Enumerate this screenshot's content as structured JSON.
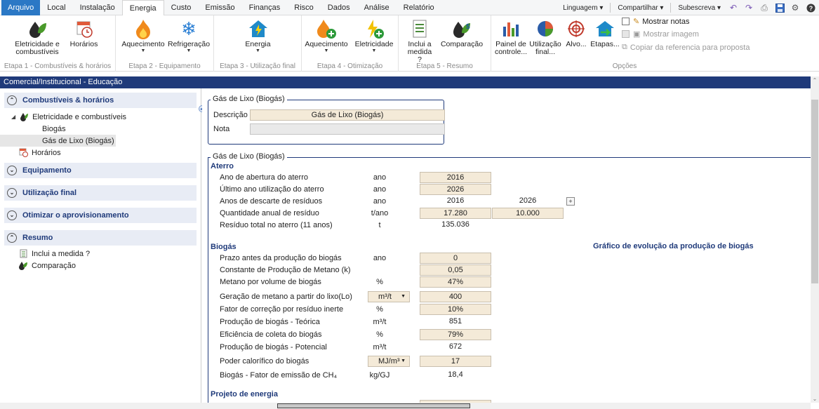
{
  "menubar": {
    "tabs": [
      "Arquivo",
      "Local",
      "Instalação",
      "Energia",
      "Custo",
      "Emissão",
      "Finanças",
      "Risco",
      "Dados",
      "Análise",
      "Relatório"
    ],
    "active_tab": "Energia",
    "language": "Linguagem ▾",
    "share": "Compartilhar ▾",
    "subscribe": "Subescreva ▾"
  },
  "ribbon": {
    "group1": {
      "label": "Etapa 1 - Combustíveis & horários",
      "btn1": "Eletricidade e combustíveis",
      "btn2": "Horários"
    },
    "group2": {
      "label": "Etapa 2 - Equipamento",
      "btn1": "Aquecimento",
      "btn2": "Refrigeração"
    },
    "group3": {
      "label": "Etapa 3 - Utilização final",
      "btn1": "Energia"
    },
    "group4": {
      "label": "Etapa 4 - Otimização",
      "btn1": "Aquecimento",
      "btn2": "Eletricidade"
    },
    "group5": {
      "label": "Etapa 5 - Resumo",
      "btn1": "Inclui a medida ?",
      "btn2": "Comparação"
    },
    "group6": {
      "label": "Opções",
      "btn1": "Painel de controle...",
      "btn2": "Utilização final...",
      "btn3": "Alvo...",
      "btn4": "Etapas...",
      "opt1": "Mostrar notas",
      "opt2": "Mostrar imagem",
      "opt3": "Copiar da referencia para proposta"
    }
  },
  "title": "Comercial/Institucional - Educação",
  "sidebar": {
    "sections": {
      "fuels": "Combustíveis & horários",
      "equipment": "Equipamento",
      "enduse": "Utilização final",
      "optimize": "Otimizar o aprovisionamento",
      "summary": "Resumo"
    },
    "tree": {
      "elec_fuels": "Eletricidade e combustíveis",
      "biogas": "Biogás",
      "landfill_gas": "Gás de Lixo (Biogás)",
      "schedules": "Horários",
      "include_measure": "Inclui a medida ?",
      "comparison": "Comparação"
    }
  },
  "main": {
    "box1": {
      "legend": "Gás de Lixo (Biogás)",
      "desc_label": "Descrição",
      "desc_value": "Gás de Lixo (Biogás)",
      "note_label": "Nota",
      "note_value": ""
    },
    "box2_legend": "Gás de Lixo (Biogás)",
    "aterro": {
      "title": "Aterro",
      "rows": [
        {
          "label": "Ano de abertura do aterro",
          "unit": "ano",
          "value": "2016"
        },
        {
          "label": "Último ano utilização do aterro",
          "unit": "ano",
          "value": "2026"
        },
        {
          "label": "Anos de descarte de resíduos",
          "unit": "ano",
          "value": "2016",
          "value2": "2026"
        },
        {
          "label": "Quantidade anual de resíduo",
          "unit": "t/ano",
          "value": "17.280",
          "value2": "10.000"
        },
        {
          "label": "Resíduo total no aterro (11 anos)",
          "unit": "t",
          "value": "135.036"
        }
      ]
    },
    "biogas": {
      "title": "Biogás",
      "rows": [
        {
          "label": "Prazo antes da produção do biogás",
          "unit": "ano",
          "value": "0"
        },
        {
          "label": "Constante de Produção de Metano (k)",
          "unit": "",
          "value": "0,05"
        },
        {
          "label": "Metano por volume de biogás",
          "unit": "%",
          "value": "47%"
        },
        {
          "label": "Geração de metano a partir do lixo(Lo)",
          "unit": "m³/t",
          "value": "400"
        },
        {
          "label": "Fator de correção por resíduo inerte",
          "unit": "%",
          "value": "10%"
        },
        {
          "label": "Produção de biogás - Teórica",
          "unit": "m³/t",
          "value": "851"
        },
        {
          "label": "Eficiência de coleta do biogás",
          "unit": "%",
          "value": "79%"
        },
        {
          "label": "Produção de biogás - Potencial",
          "unit": "m³/t",
          "value": "672"
        },
        {
          "label": "Poder calorífico do biogás",
          "unit": "MJ/m³",
          "value": "17"
        },
        {
          "label": "Biogás - Fator de emissão de CH₄",
          "unit": "kg/GJ",
          "value": "18,4"
        }
      ]
    },
    "energy_project_title": "Projeto de energia",
    "chart_title": "Gráfico de evolução da produção de biogás"
  },
  "colors": {
    "accent": "#1f3a7a",
    "input_bg": "#f4ead8",
    "file_tab": "#2b78c5"
  }
}
